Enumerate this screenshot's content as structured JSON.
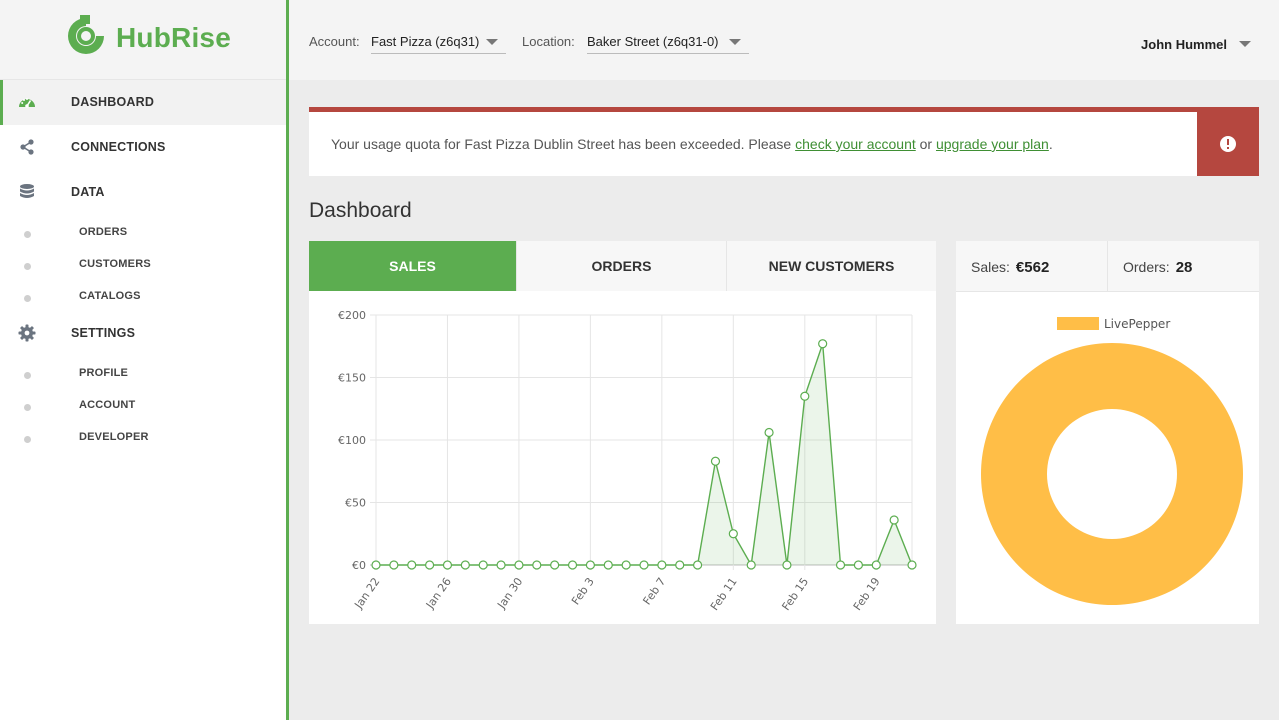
{
  "brand": {
    "name": "HubRise",
    "color": "#5cad50"
  },
  "sidebar": {
    "items": [
      {
        "label": "DASHBOARD",
        "icon": "dashboard-icon"
      },
      {
        "label": "CONNECTIONS",
        "icon": "share-icon"
      },
      {
        "label": "DATA",
        "icon": "database-icon"
      },
      {
        "label": "SETTINGS",
        "icon": "gear-icon"
      }
    ],
    "data_sub": [
      "ORDERS",
      "CUSTOMERS",
      "CATALOGS"
    ],
    "settings_sub": [
      "PROFILE",
      "ACCOUNT",
      "DEVELOPER"
    ]
  },
  "header": {
    "account_label": "Account:",
    "account_value": "Fast Pizza (z6q31)",
    "location_label": "Location:",
    "location_value": "Baker Street (z6q31-0)",
    "user": "John Hummel"
  },
  "alert": {
    "text_before": "Your usage quota for Fast Pizza Dublin Street has been exceeded. Please ",
    "link1": "check your account",
    "text_mid": " or ",
    "link2": "upgrade your plan",
    "text_after": ".",
    "color": "#b5473f",
    "icon": "exclamation-icon"
  },
  "page_title": "Dashboard",
  "tabs": [
    "SALES",
    "ORDERS",
    "NEW CUSTOMERS"
  ],
  "stats": {
    "sales_label": "Sales:",
    "sales_value": "€562",
    "orders_label": "Orders:",
    "orders_value": "28"
  },
  "chart_data": [
    {
      "type": "area",
      "x": [
        "Jan 22",
        "Jan 23",
        "Jan 24",
        "Jan 25",
        "Jan 26",
        "Jan 27",
        "Jan 28",
        "Jan 29",
        "Jan 30",
        "Jan 31",
        "Feb 1",
        "Feb 2",
        "Feb 3",
        "Feb 4",
        "Feb 5",
        "Feb 6",
        "Feb 7",
        "Feb 8",
        "Feb 9",
        "Feb 10",
        "Feb 11",
        "Feb 12",
        "Feb 13",
        "Feb 14",
        "Feb 15",
        "Feb 16",
        "Feb 17",
        "Feb 18",
        "Feb 19",
        "Feb 20",
        "Feb 21"
      ],
      "values": [
        0,
        0,
        0,
        0,
        0,
        0,
        0,
        0,
        0,
        0,
        0,
        0,
        0,
        0,
        0,
        0,
        0,
        0,
        0,
        83,
        25,
        0,
        106,
        0,
        135,
        177,
        0,
        0,
        0,
        36,
        0
      ],
      "tick_labels": [
        "Jan 22",
        "Jan 26",
        "Jan 30",
        "Feb 3",
        "Feb 7",
        "Feb 11",
        "Feb 15",
        "Feb 19"
      ],
      "y_ticks": [
        "€0",
        "€50",
        "€100",
        "€150",
        "€200"
      ],
      "ylim": [
        0,
        200
      ],
      "grid": true,
      "color": "#5cad50"
    },
    {
      "type": "pie",
      "labels": [
        "LivePepper"
      ],
      "values": [
        562
      ],
      "colors": [
        "#ffbe47"
      ],
      "legend_position": "top"
    }
  ]
}
